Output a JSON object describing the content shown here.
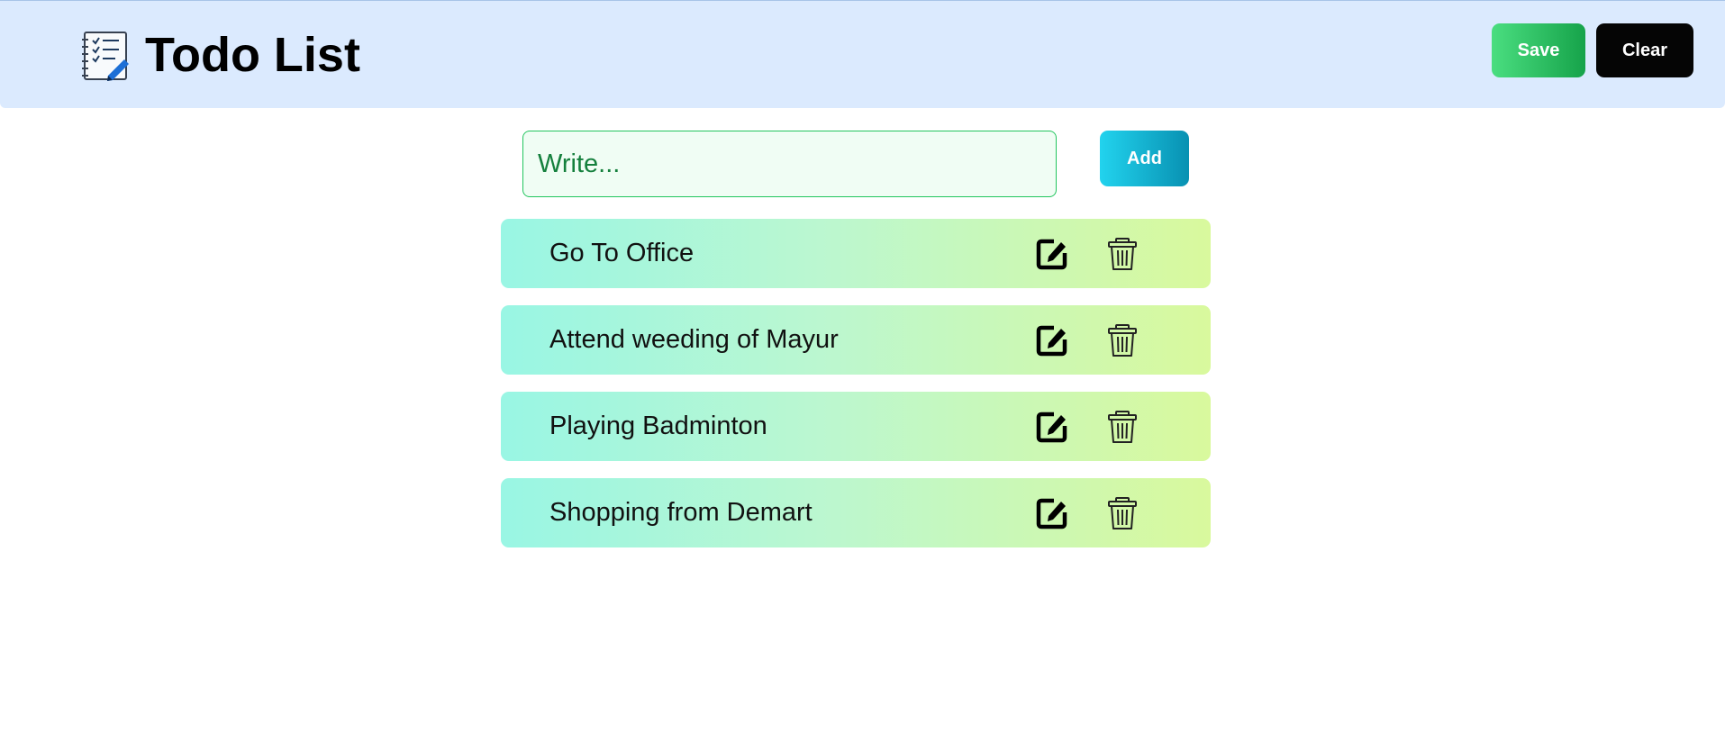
{
  "header": {
    "title": "Todo List",
    "logo_icon": "checklist-notebook-icon",
    "save_label": "Save",
    "clear_label": "Clear"
  },
  "input": {
    "placeholder": "Write...",
    "value": "",
    "add_label": "Add"
  },
  "todos": [
    {
      "text": "Go To Office",
      "edit_icon": "edit-icon",
      "delete_icon": "trash-icon"
    },
    {
      "text": "Attend weeding of Mayur",
      "edit_icon": "edit-icon",
      "delete_icon": "trash-icon"
    },
    {
      "text": "Playing Badminton",
      "edit_icon": "edit-icon",
      "delete_icon": "trash-icon"
    },
    {
      "text": "Shopping from Demart",
      "edit_icon": "edit-icon",
      "delete_icon": "trash-icon"
    }
  ],
  "colors": {
    "header_bg": "#dbeafe",
    "save_green": "#22c55e",
    "clear_black": "#050505",
    "add_cyan": "#06b6d4",
    "input_border": "#22c55e",
    "item_gradient_start": "#99f6e4",
    "item_gradient_end": "#d9f99d"
  }
}
